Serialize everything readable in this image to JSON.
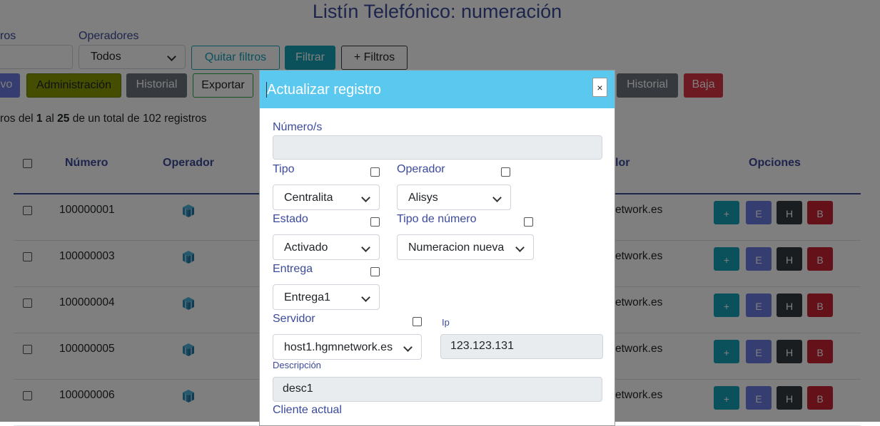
{
  "page": {
    "title": "Listín Telefónico: numeración",
    "filters": {
      "first_label": "ros",
      "operators_label": "Operadores",
      "operators_value": "Todos",
      "clear_label": "Quitar filtros",
      "filter_label": "Filtrar",
      "more_label": "+ Filtros"
    },
    "actions": {
      "nuevo_label": "vo",
      "admin_label": "Administración",
      "historial_label": "Historial",
      "exportar_label": "Exportar",
      "historial2_label": "Historial",
      "baja_label": "Baja"
    },
    "count": {
      "prefix": "ros del ",
      "from": "1",
      "mid": " al ",
      "to": "25",
      "suffix": " de un total de 102 registros"
    },
    "table": {
      "headers": {
        "numero": "Número",
        "operador": "Operador",
        "servidor": "lor",
        "opciones": "Opciones"
      },
      "rows": [
        {
          "numero": "100000001",
          "servidor": "etwork.es"
        },
        {
          "numero": "100000003",
          "servidor": "etwork.es"
        },
        {
          "numero": "100000004",
          "servidor": "etwork.es"
        },
        {
          "numero": "100000005",
          "servidor": "etwork.es"
        },
        {
          "numero": "100000006",
          "servidor": "etwork.es"
        }
      ],
      "row_buttons": {
        "add": "+",
        "edit": "E",
        "history": "H",
        "delete": "B"
      }
    }
  },
  "modal": {
    "title": "Actualizar registro",
    "close": "×",
    "numeros_label": "Número/s",
    "numeros_value": "",
    "tipo_label": "Tipo",
    "tipo_value": "Centralita",
    "operador_label": "Operador",
    "operador_value": "Alisys",
    "estado_label": "Estado",
    "estado_value": "Activado",
    "tipo_numero_label": "Tipo de número",
    "tipo_numero_value": "Numeracion nueva",
    "entrega_label": "Entrega",
    "entrega_value": "Entrega1",
    "servidor_label": "Servidor",
    "servidor_value": "host1.hgmnetwork.es",
    "ip_label": "Ip",
    "ip_value": "123.123.131",
    "descripcion_label": "Descripción",
    "descripcion_value": "desc1",
    "cliente_label": "Cliente actual"
  },
  "colors": {
    "accent_title": "#3b4a9a",
    "modal_header": "#5bc8ef",
    "btn_info": "#17a2b8",
    "btn_primary": "#6c7ae0",
    "btn_dark": "#343a40",
    "btn_danger": "#c82333",
    "btn_admin": "#8a9a00"
  },
  "icons": {
    "operator": "cube-icon",
    "chevron": "chevron-down-icon",
    "close": "close-icon"
  }
}
